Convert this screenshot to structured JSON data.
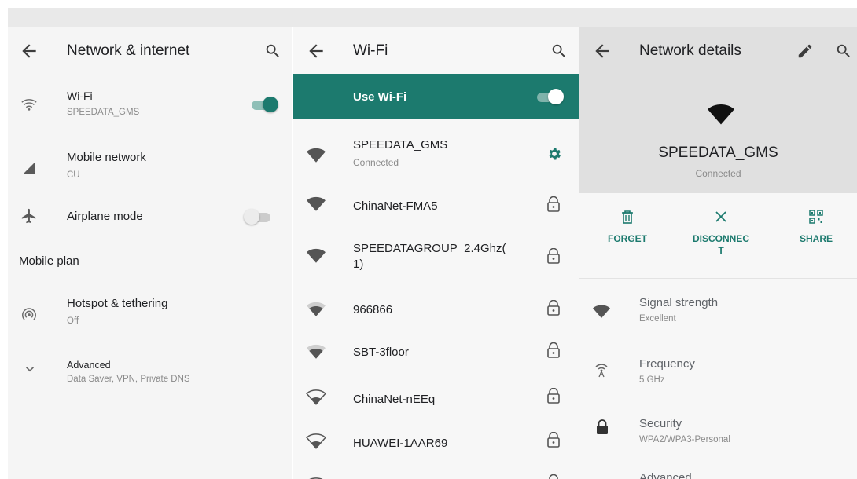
{
  "colors": {
    "accent": "#1c7a6e",
    "toolbar_bg": "#e0e0e0",
    "text_primary": "#202124",
    "text_secondary": "#8a8a8a"
  },
  "network_internet": {
    "title": "Network & internet",
    "items": [
      {
        "icon": "wifi-icon",
        "label": "Wi-Fi",
        "sublabel": "SPEEDATA_GMS",
        "toggle": "on"
      },
      {
        "icon": "cellular-signal-icon",
        "label": "Mobile network",
        "sublabel": "CU"
      },
      {
        "icon": "airplane-icon",
        "label": "Airplane mode",
        "toggle": "off"
      },
      {
        "icon": "hotspot-icon",
        "label": "Hotspot & tethering",
        "sublabel": "Off"
      },
      {
        "icon": "chevron-down-icon",
        "label": "Advanced",
        "sublabel": "Data Saver, VPN, Private DNS"
      }
    ],
    "section_mobile_plan": "Mobile plan"
  },
  "wifi": {
    "title": "Wi-Fi",
    "use_wifi_label": "Use Wi-Fi",
    "use_wifi_toggle": "on",
    "networks": [
      {
        "ssid": "SPEEDATA_GMS",
        "status": "Connected",
        "icon": "wifi-full-icon",
        "action": "gear-icon"
      },
      {
        "ssid": "ChinaNet-FMA5",
        "icon": "wifi-full-icon",
        "action": "lock-icon"
      },
      {
        "ssid": "SPEEDATAGROUP_2.4Ghz(",
        "ssid_line2": "1)",
        "icon": "wifi-full-icon",
        "action": "lock-icon"
      },
      {
        "ssid": "966866",
        "icon": "wifi-strong-icon",
        "action": "lock-icon"
      },
      {
        "ssid": "SBT-3floor",
        "icon": "wifi-strong-icon",
        "action": "lock-icon"
      },
      {
        "ssid": "ChinaNet-nEEq",
        "icon": "wifi-medium-icon",
        "action": "lock-icon"
      },
      {
        "ssid": "HUAWEI-1AAR69",
        "icon": "wifi-medium-icon",
        "action": "lock-icon"
      }
    ]
  },
  "network_details": {
    "title": "Network details",
    "ssid": "SPEEDATA_GMS",
    "status": "Connected",
    "actions": [
      {
        "icon": "trash-icon",
        "label": "FORGET"
      },
      {
        "icon": "close-icon",
        "label_line1": "DISCONNEC",
        "label_line2": "T"
      },
      {
        "icon": "qr-code-icon",
        "label": "SHARE"
      }
    ],
    "details": [
      {
        "icon": "wifi-full-icon",
        "label": "Signal strength",
        "value": "Excellent"
      },
      {
        "icon": "frequency-icon",
        "label": "Frequency",
        "value": "5 GHz"
      },
      {
        "icon": "lock-icon",
        "label": "Security",
        "value": "WPA2/WPA3-Personal"
      }
    ],
    "partial_label": "Advanced"
  }
}
